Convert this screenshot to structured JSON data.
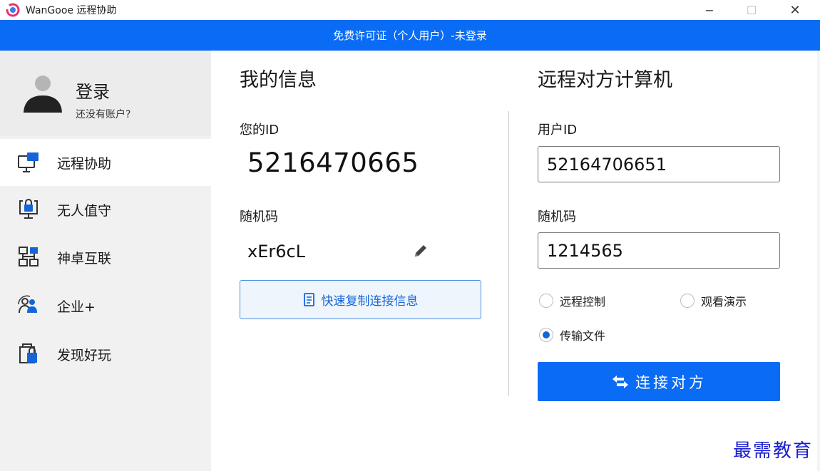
{
  "window": {
    "title": "WanGooe 远程协助",
    "min_symbol": "−",
    "max_symbol": "☐",
    "close_symbol": "✕"
  },
  "banner": {
    "text": "免费许可证（个人用户）-未登录"
  },
  "profile": {
    "login": "登录",
    "no_account": "还没有账户?"
  },
  "sidebar": {
    "items": [
      {
        "label": "远程协助",
        "icon": "remote-desktop-icon",
        "active": true
      },
      {
        "label": "无人值守",
        "icon": "unattended-lock-icon",
        "active": false
      },
      {
        "label": "神卓互联",
        "icon": "network-icon",
        "active": false
      },
      {
        "label": "企业+",
        "icon": "enterprise-users-icon",
        "active": false
      },
      {
        "label": "发现好玩",
        "icon": "shopping-bag-icon",
        "active": false
      }
    ]
  },
  "my_info": {
    "title": "我的信息",
    "id_label": "您的ID",
    "id_value": "5216470665",
    "code_label": "随机码",
    "code_value": "xEr6cL",
    "copy_button": "快速复制连接信息"
  },
  "remote": {
    "title": "远程对方计算机",
    "user_id_label": "用户ID",
    "user_id_value": "52164706651",
    "code_label": "随机码",
    "code_value": "1214565",
    "modes": [
      {
        "label": "远程控制",
        "checked": false
      },
      {
        "label": "观看演示",
        "checked": false
      },
      {
        "label": "传输文件",
        "checked": true
      }
    ],
    "connect_button": "连接对方"
  },
  "watermark": "最需教育",
  "colors": {
    "accent": "#0a6cf5",
    "link": "#1565d8",
    "watermark": "#1b1fd0"
  }
}
